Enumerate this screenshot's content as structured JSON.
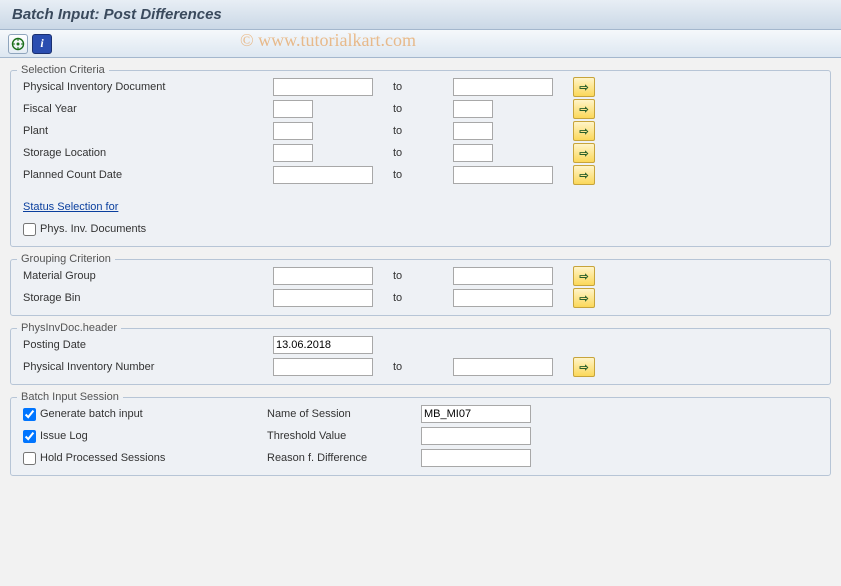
{
  "title": "Batch Input: Post Differences",
  "toolbar": {
    "execute": "⊕",
    "info": "ℹ"
  },
  "watermark": "© www.tutorialkart.com",
  "to_label": "to",
  "multi_glyph": "⇨",
  "selection": {
    "legend": "Selection Criteria",
    "phys_inv_doc": "Physical Inventory Document",
    "fiscal_year": "Fiscal Year",
    "plant": "Plant",
    "storage_loc": "Storage Location",
    "planned_date": "Planned Count Date",
    "status_link": "Status Selection for",
    "phys_inv_check": "Phys. Inv. Documents"
  },
  "grouping": {
    "legend": "Grouping Criterion",
    "material_group": "Material Group",
    "storage_bin": "Storage Bin"
  },
  "header": {
    "legend": "PhysInvDoc.header",
    "posting_date": "Posting Date",
    "posting_date_val": "13.06.2018",
    "phys_inv_number": "Physical Inventory Number"
  },
  "batch": {
    "legend": "Batch Input Session",
    "generate": "Generate batch input",
    "issue_log": "Issue Log",
    "hold_processed": "Hold Processed Sessions",
    "name_of_session": "Name of Session",
    "name_of_session_val": "MB_MI07",
    "threshold": "Threshold Value",
    "reason": "Reason f. Difference"
  }
}
